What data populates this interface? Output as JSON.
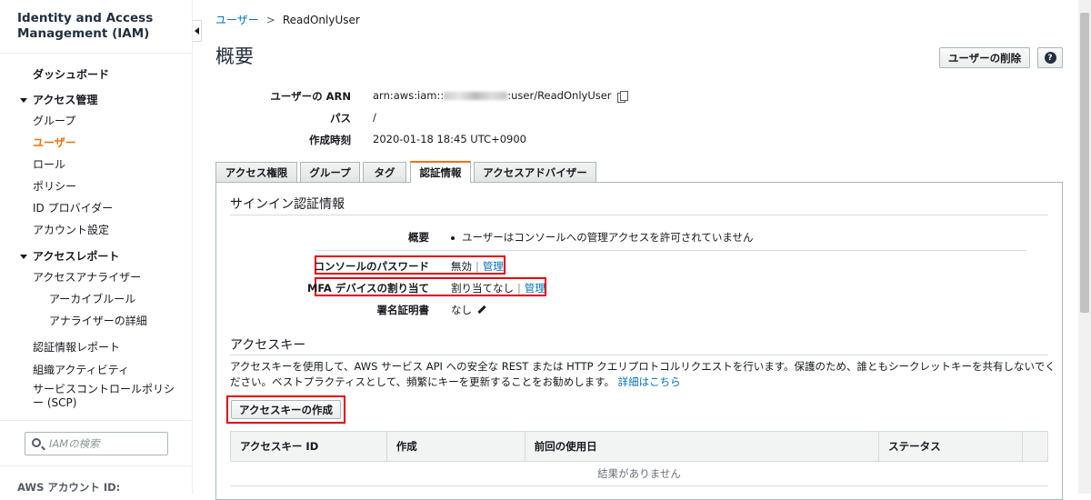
{
  "sidebar": {
    "title": "Identity and Access Management (IAM)",
    "dashboard": "ダッシュボード",
    "access_mgmt": "アクセス管理",
    "groups": "グループ",
    "users": "ユーザー",
    "roles": "ロール",
    "policies": "ポリシー",
    "id_providers": "ID プロバイダー",
    "account_settings": "アカウント設定",
    "access_reports": "アクセスレポート",
    "access_analyzer": "アクセスアナライザー",
    "archive_rules": "アーカイブルール",
    "analyzer_details": "アナライザーの詳細",
    "credential_report": "認証情報レポート",
    "org_activity": "組織アクティビティ",
    "scp": "サービスコントロールポリシー (SCP)",
    "search_placeholder": "IAMの検索",
    "account_id_label": "AWS アカウント ID:"
  },
  "breadcrumb": {
    "parent": "ユーザー",
    "separator": ">",
    "current": "ReadOnlyUser"
  },
  "page": {
    "title": "概要",
    "delete_button": "ユーザーの削除",
    "help_icon": "?"
  },
  "summary": {
    "arn_label": "ユーザーの ARN",
    "arn_prefix": "arn:aws:iam::",
    "arn_suffix": ":user/ReadOnlyUser",
    "path_label": "パス",
    "path_value": "/",
    "created_label": "作成時刻",
    "created_value": "2020-01-18 18:45 UTC+0900"
  },
  "tabs": [
    "アクセス権限",
    "グループ",
    "タグ",
    "認証情報",
    "アクセスアドバイザー"
  ],
  "active_tab": "認証情報",
  "signin": {
    "heading": "サインイン認証情報",
    "summary_label": "概要",
    "summary_value": "ユーザーはコンソールへの管理アクセスを許可されていません",
    "console_pw_label": "コンソールのパスワード",
    "console_pw_value": "無効",
    "manage": "管理",
    "mfa_label": "MFA デバイスの割り当て",
    "mfa_value": "割り当てなし",
    "cert_label": "署名証明書",
    "cert_value": "なし"
  },
  "access_keys": {
    "heading": "アクセスキー",
    "description": "アクセスキーを使用して、AWS サービス API への安全な REST または HTTP クエリプロトコルリクエストを行います。保護のため、誰ともシークレットキーを共有しないでください。ベストプラクティスとして、頻繁にキーを更新することをお勧めします。",
    "learn_more": "詳細はこちら",
    "create_button": "アクセスキーの作成",
    "columns": [
      "アクセスキー ID",
      "作成",
      "前回の使用日",
      "ステータス",
      ""
    ],
    "empty_text": "結果がありません"
  },
  "colors": {
    "accent": "#ec7211",
    "link": "#0073bb",
    "highlight_box": "#e3000f"
  }
}
